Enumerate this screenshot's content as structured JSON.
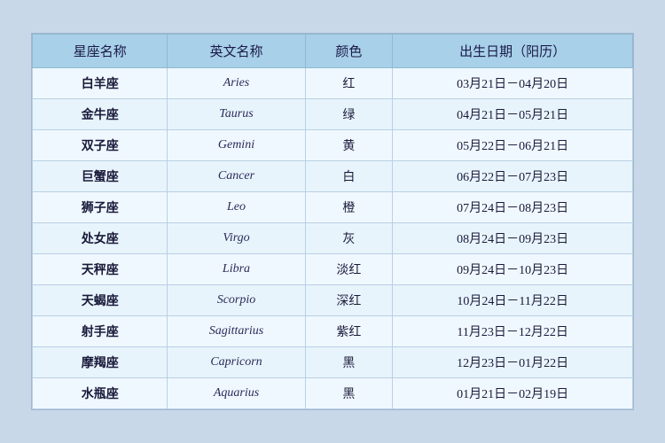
{
  "table": {
    "headers": [
      "星座名称",
      "英文名称",
      "颜色",
      "出生日期（阳历）"
    ],
    "rows": [
      {
        "chinese": "白羊座",
        "english": "Aries",
        "color": "红",
        "dates": "03月21日－04月20日"
      },
      {
        "chinese": "金牛座",
        "english": "Taurus",
        "color": "绿",
        "dates": "04月21日－05月21日"
      },
      {
        "chinese": "双子座",
        "english": "Gemini",
        "color": "黄",
        "dates": "05月22日－06月21日"
      },
      {
        "chinese": "巨蟹座",
        "english": "Cancer",
        "color": "白",
        "dates": "06月22日－07月23日"
      },
      {
        "chinese": "狮子座",
        "english": "Leo",
        "color": "橙",
        "dates": "07月24日－08月23日"
      },
      {
        "chinese": "处女座",
        "english": "Virgo",
        "color": "灰",
        "dates": "08月24日－09月23日"
      },
      {
        "chinese": "天秤座",
        "english": "Libra",
        "color": "淡红",
        "dates": "09月24日－10月23日"
      },
      {
        "chinese": "天蝎座",
        "english": "Scorpio",
        "color": "深红",
        "dates": "10月24日－11月22日"
      },
      {
        "chinese": "射手座",
        "english": "Sagittarius",
        "color": "紫红",
        "dates": "11月23日－12月22日"
      },
      {
        "chinese": "摩羯座",
        "english": "Capricorn",
        "color": "黑",
        "dates": "12月23日－01月22日"
      },
      {
        "chinese": "水瓶座",
        "english": "Aquarius",
        "color": "黑",
        "dates": "01月21日－02月19日"
      }
    ]
  }
}
